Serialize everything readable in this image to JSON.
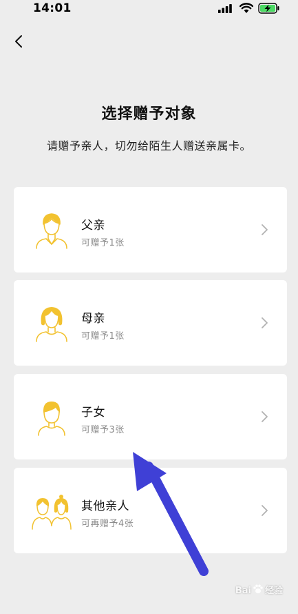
{
  "status_bar": {
    "time": "14:01",
    "icons": [
      "signal-icon",
      "wifi-icon",
      "battery-charging-icon"
    ]
  },
  "nav": {
    "back_icon": "chevron-left-icon"
  },
  "title": "选择赠予对象",
  "subtitle": "请赠予亲人，切勿给陌生人赠送亲属卡。",
  "colors": {
    "background": "#ededed",
    "card": "#ffffff",
    "accent_yellow": "#f2c230",
    "annotation_arrow": "#3f40d6"
  },
  "recipients": [
    {
      "name": "父亲",
      "sub": "可赠予1张",
      "icon": "father-avatar-icon"
    },
    {
      "name": "母亲",
      "sub": "可赠予1张",
      "icon": "mother-avatar-icon"
    },
    {
      "name": "子女",
      "sub": "可赠予3张",
      "icon": "child-avatar-icon"
    },
    {
      "name": "其他亲人",
      "sub": "可再赠予4张",
      "icon": "relatives-avatar-icon"
    }
  ],
  "watermark": {
    "brand": "Bai",
    "text": "经验"
  }
}
